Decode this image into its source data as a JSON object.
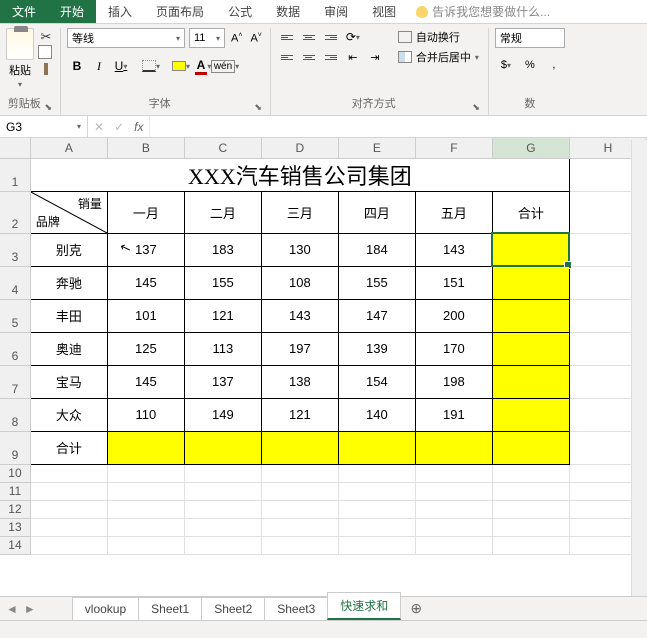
{
  "ribbon_tabs": {
    "file": "文件",
    "home": "开始",
    "insert": "插入",
    "layout": "页面布局",
    "formulas": "公式",
    "data": "数据",
    "review": "审阅",
    "view": "视图",
    "tellme": "告诉我您想要做什么..."
  },
  "ribbon": {
    "clipboard": {
      "label": "剪贴板",
      "paste": "粘贴"
    },
    "font": {
      "label": "字体",
      "name": "等线",
      "size": "11",
      "bold": "B",
      "italic": "I",
      "underline": "U",
      "fontcolor_letter": "A",
      "wen": "wén"
    },
    "alignment": {
      "label": "对齐方式",
      "wrap": "自动换行",
      "merge": "合并后居中"
    },
    "number": {
      "label": "数",
      "format": "常规"
    }
  },
  "namebox": "G3",
  "columns": [
    "A",
    "B",
    "C",
    "D",
    "E",
    "F",
    "G",
    "H"
  ],
  "rows": [
    "1",
    "2",
    "3",
    "4",
    "5",
    "6",
    "7",
    "8",
    "9",
    "10",
    "11",
    "12",
    "13",
    "14"
  ],
  "sheets": {
    "items": [
      "vlookup",
      "Sheet1",
      "Sheet2",
      "Sheet3",
      "快速求和"
    ],
    "active": 4,
    "new": "⊕"
  },
  "chart_data": {
    "type": "table",
    "title": "XXX汽车销售公司集团",
    "diag_top": "销量",
    "diag_bottom": "品牌",
    "col_headers": [
      "一月",
      "二月",
      "三月",
      "四月",
      "五月",
      "合计"
    ],
    "row_headers": [
      "别克",
      "奔驰",
      "丰田",
      "奥迪",
      "宝马",
      "大众",
      "合计"
    ],
    "values": [
      [
        137,
        183,
        130,
        184,
        143,
        null
      ],
      [
        145,
        155,
        108,
        155,
        151,
        null
      ],
      [
        101,
        121,
        143,
        147,
        200,
        null
      ],
      [
        125,
        113,
        197,
        139,
        170,
        null
      ],
      [
        145,
        137,
        138,
        154,
        198,
        null
      ],
      [
        110,
        149,
        121,
        140,
        191,
        null
      ],
      [
        null,
        null,
        null,
        null,
        null,
        null
      ]
    ]
  }
}
